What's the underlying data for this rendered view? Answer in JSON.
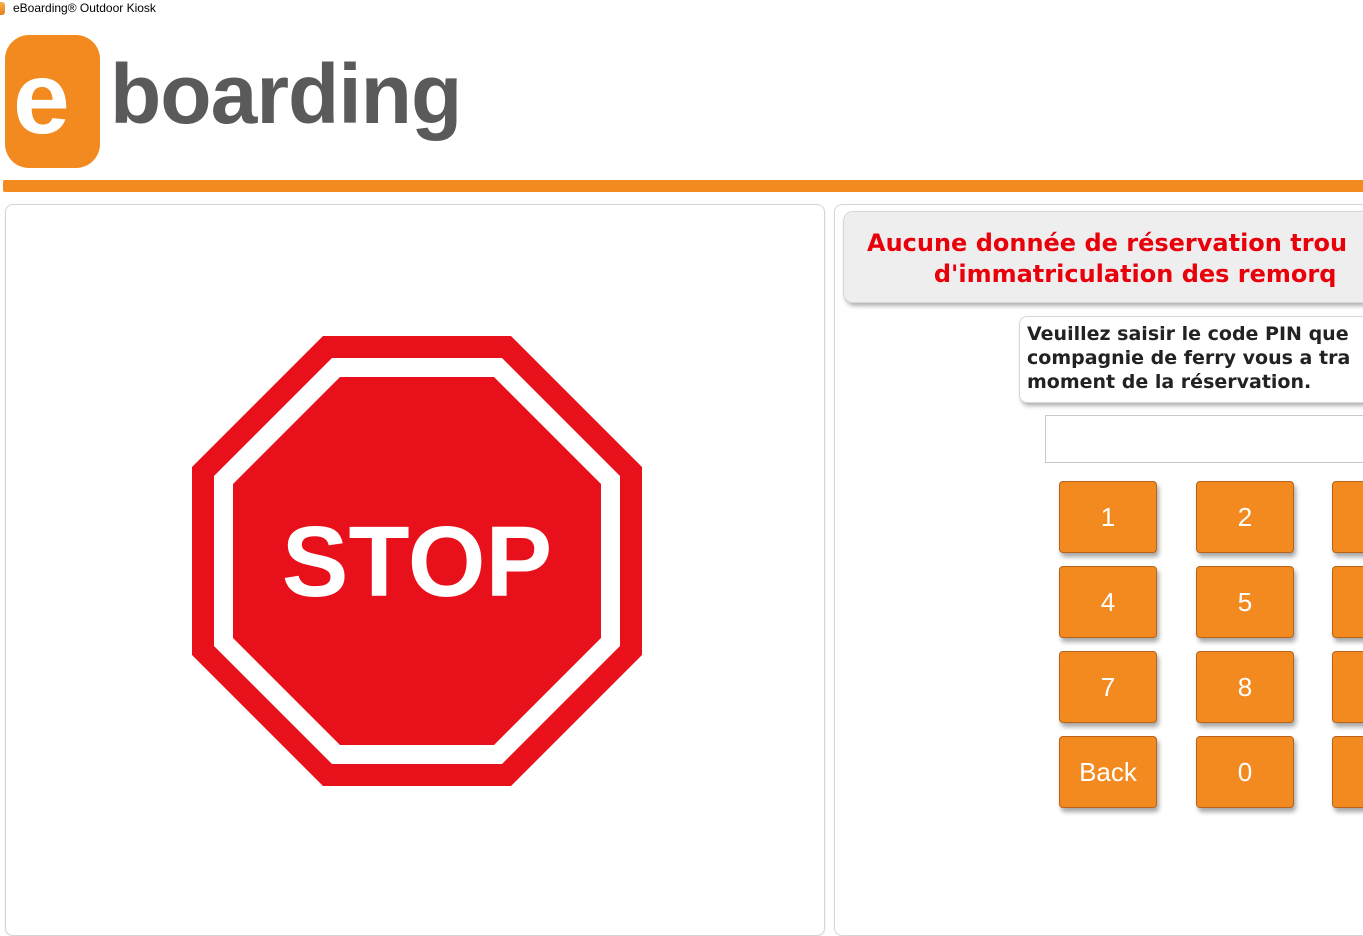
{
  "window": {
    "title": "eBoarding® Outdoor Kiosk"
  },
  "logo": {
    "letter": "e",
    "word": "boarding"
  },
  "stop_sign": {
    "text": "STOP"
  },
  "message": {
    "text": "Aucune donnée de réservation trou\n        d'immatriculation des remorq"
  },
  "instruction": {
    "text": "Veuillez saisir le code PIN que\ncompagnie de ferry vous a tra\nmoment de la réservation."
  },
  "pin_input": {
    "value": ""
  },
  "keypad": {
    "keys": [
      "1",
      "2",
      "",
      "4",
      "5",
      "",
      "7",
      "8",
      "",
      "Back",
      "0",
      ""
    ]
  },
  "colors": {
    "brand_orange": "#f28a1f",
    "logo_gray": "#5a5a5a",
    "error_red": "#e8000b",
    "stop_red": "#e8101a"
  }
}
